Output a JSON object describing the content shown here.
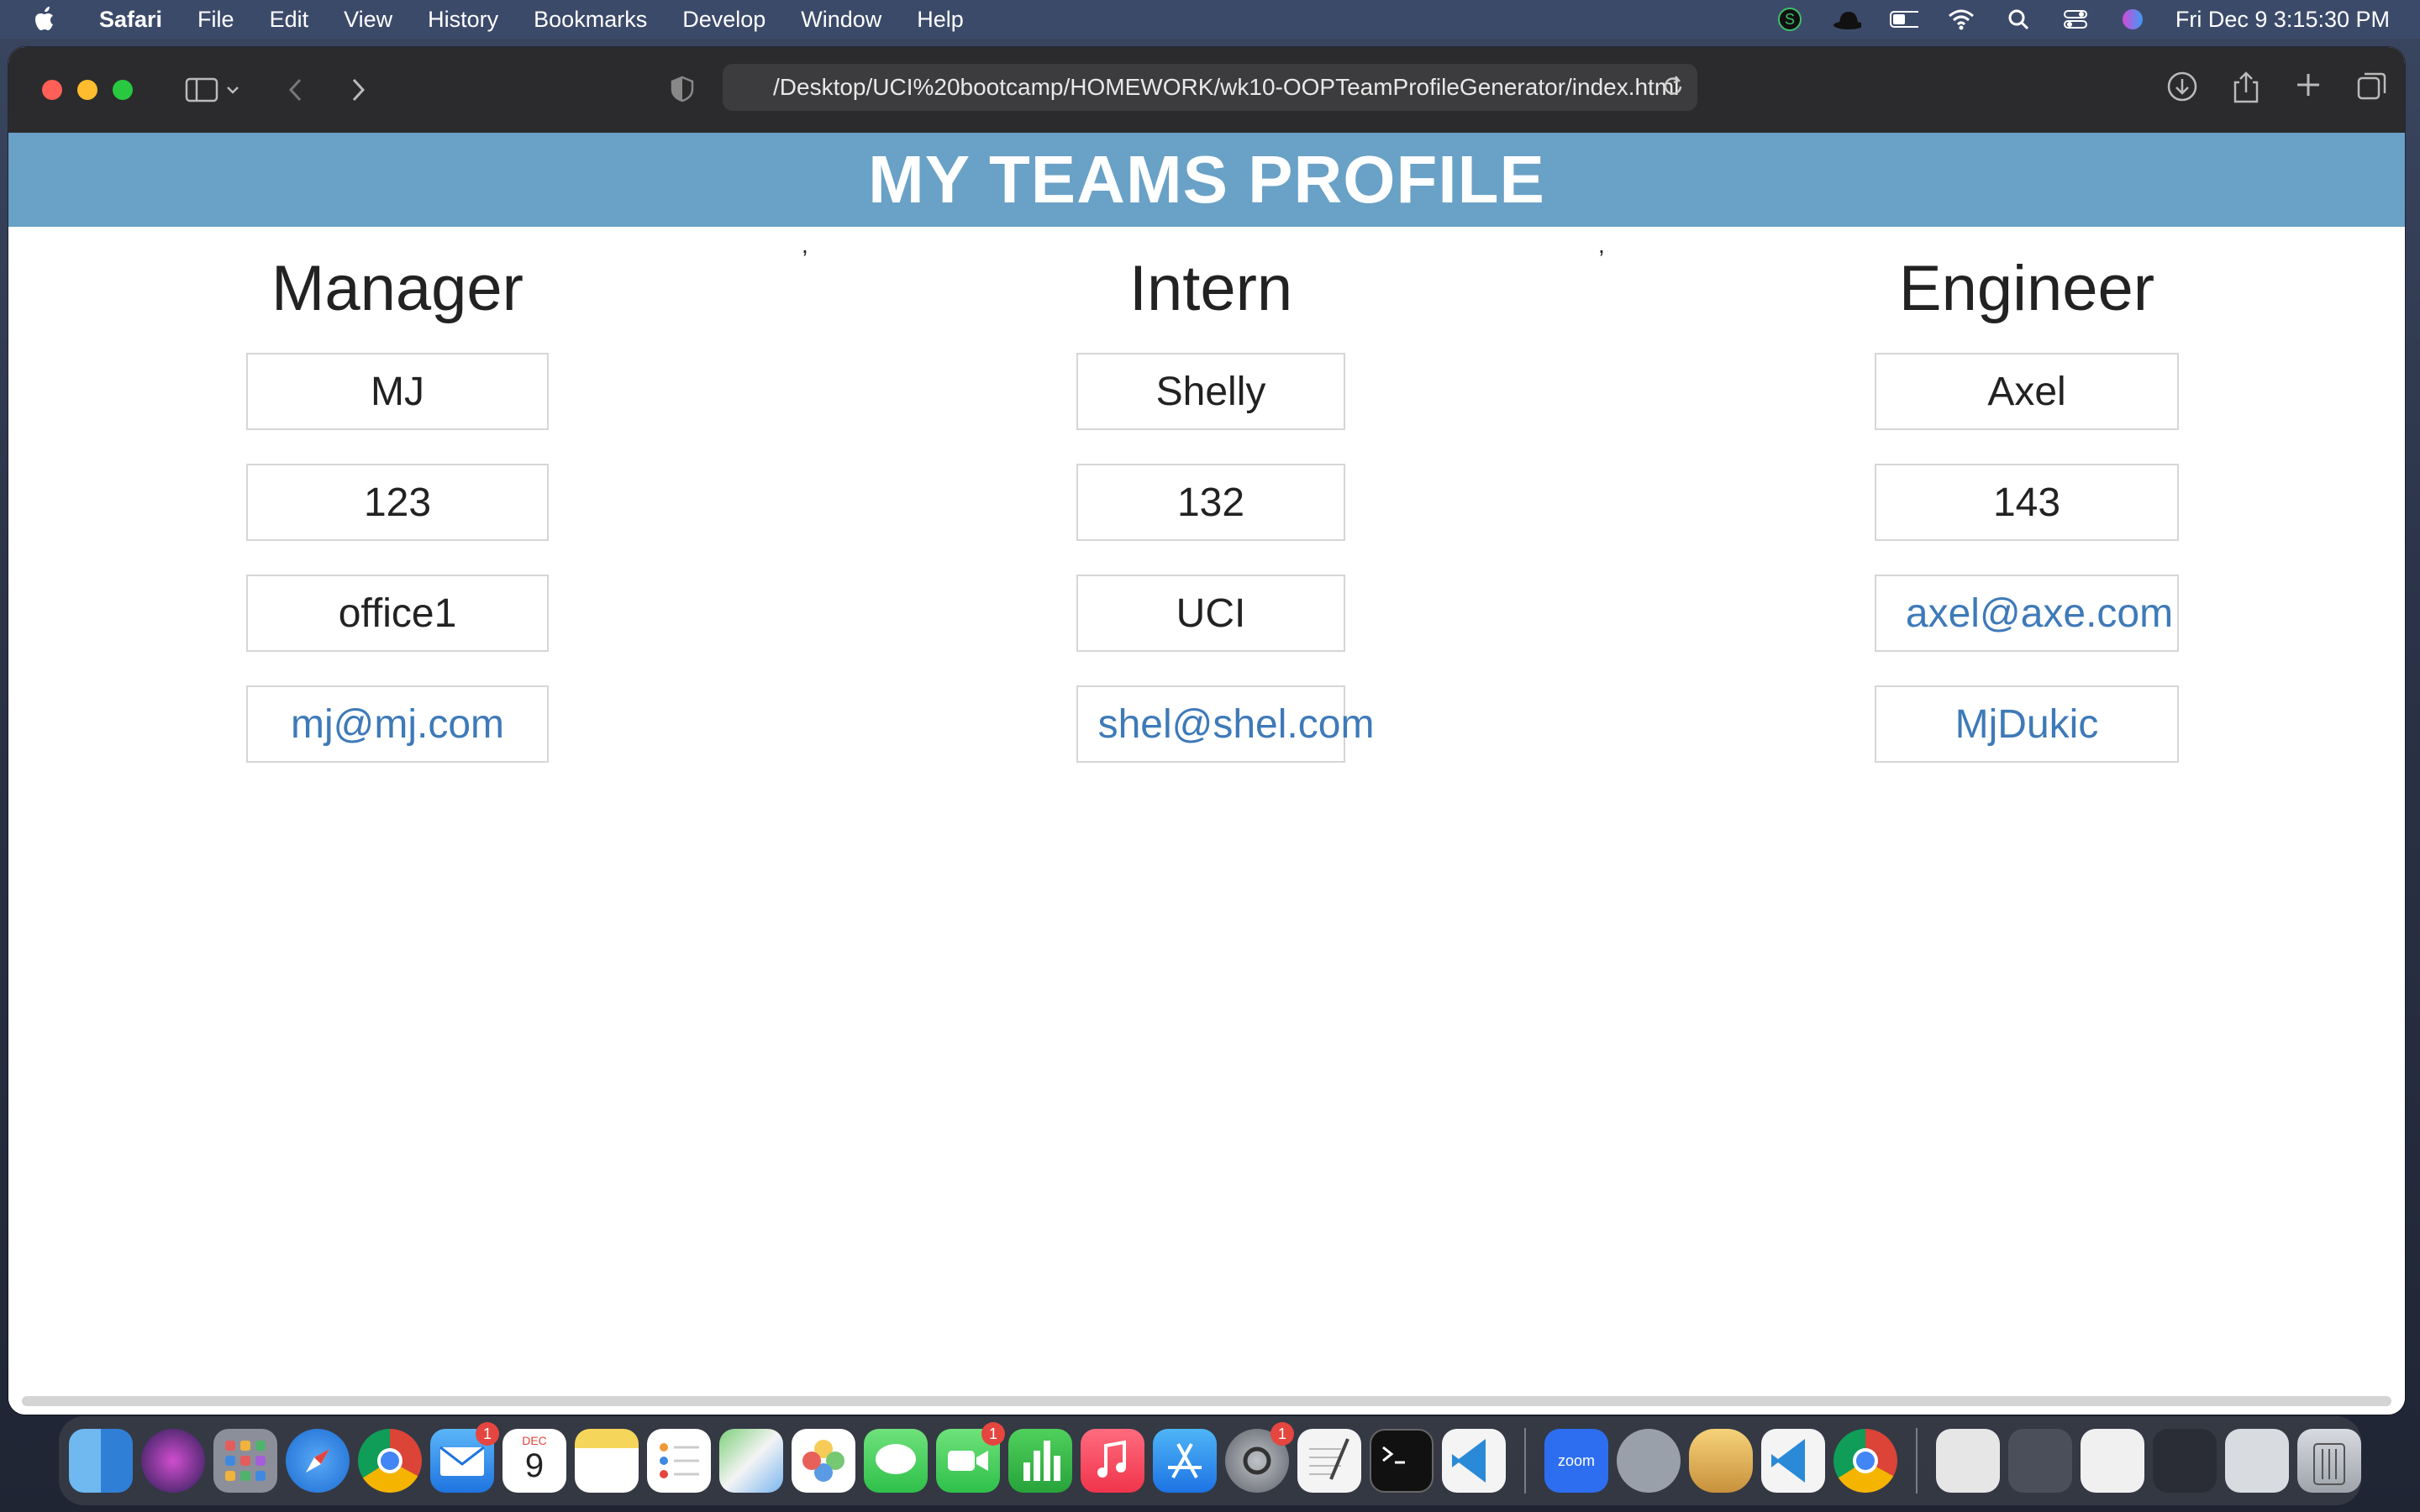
{
  "menubar": {
    "app_name": "Safari",
    "items": [
      "File",
      "Edit",
      "View",
      "History",
      "Bookmarks",
      "Develop",
      "Window",
      "Help"
    ],
    "clock": "Fri Dec 9  3:15:30 PM"
  },
  "browser": {
    "url": "/Desktop/UCI%20bootcamp/HOMEWORK/wk10-OOPTeamProfileGenerator/index.html"
  },
  "page": {
    "banner_title": "MY TEAMS PROFILE",
    "separator": ",",
    "columns": [
      {
        "role": "Manager",
        "fields": [
          "MJ",
          "123",
          "office1",
          "mj@mj.com"
        ]
      },
      {
        "role": "Intern",
        "fields": [
          "Shelly",
          "132",
          "UCI",
          "shel@shel.com"
        ]
      },
      {
        "role": "Engineer",
        "fields": [
          "Axel",
          "143",
          "axel@axe.com",
          "MjDukic"
        ]
      }
    ]
  },
  "dock": {
    "calendar_month": "DEC",
    "calendar_day": "9",
    "mail_badge": "1",
    "facetime_badge": "1",
    "settings_badge": "1",
    "zoom_label": "zoom"
  }
}
